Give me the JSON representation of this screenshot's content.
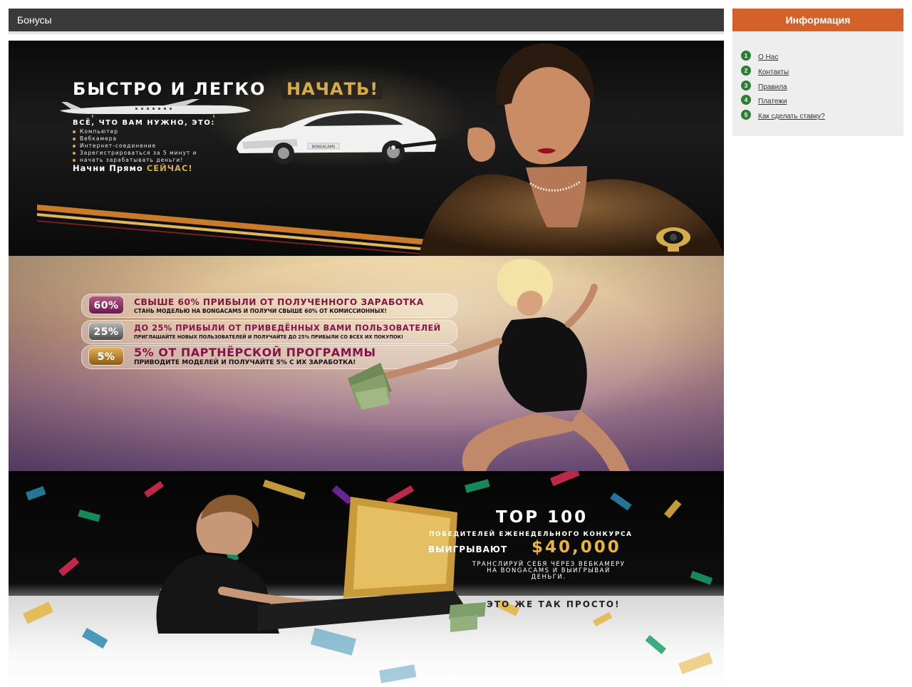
{
  "section": {
    "title": "Бонусы"
  },
  "banners": {
    "b1": {
      "title": "БЫСТРО И ЛЕГКО",
      "title_highlight": "НАЧАТЬ!",
      "needs_title": "ВСЁ, ЧТО ВАМ НУЖНО, ЭТО:",
      "needs": [
        "Компьютер",
        "Вебкамера",
        "Интернет-соединение",
        "Зарегистрироваться за 5 минут и",
        "начать зарабатывать деньги!"
      ],
      "cta": "Начни Прямо",
      "cta_highlight": "СЕЙЧАС!",
      "car_plate": "BONGACAMS"
    },
    "b2": {
      "rows": [
        {
          "badge": "60%",
          "headline": "СВЫШЕ 60% ПРИБЫЛИ ОТ ПОЛУЧЕННОГО ЗАРАБОТКА",
          "subline": "СТАНЬ МОДЕЛЬЮ НА BONGACAMS И ПОЛУЧИ СВЫШЕ 60% ОТ КОМИССИОННЫХ!"
        },
        {
          "badge": "25%",
          "headline": "ДО 25% ПРИБЫЛИ ОТ ПРИВЕДЁННЫХ ВАМИ ПОЛЬЗОВАТЕЛЕЙ",
          "subline": "ПРИГЛАШАЙТЕ НОВЫХ ПОЛЬЗОВАТЕЛЕЙ И ПОЛУЧАЙТЕ ДО 25% ПРИБЫЛИ СО ВСЕХ ИХ ПОКУПОК!"
        },
        {
          "badge": "5%",
          "headline": "5% ОТ ПАРТНЁРСКОЙ ПРОГРАММЫ",
          "subline": "ПРИВОДИТЕ МОДЕЛЕЙ И ПОЛУЧАЙТЕ 5% С ИХ ЗАРАБОТКА!"
        }
      ]
    },
    "b3": {
      "top": "TOP 100",
      "line1": "ПОБЕДИТЕЛЕЙ ЕЖЕНЕДЕЛЬНОГО КОНКУРСА",
      "win": "ВЫИГРЫВАЮТ",
      "amount": "$40,000",
      "desc": "ТРАНСЛИРУЙ СЕБЯ ЧЕРЕЗ ВЕБКАМЕРУ НА BONGACAMS И ВЫИГРЫВАЙ ДЕНЬГИ.",
      "easy": "ЭТО ЖЕ ТАК ПРОСТО!"
    }
  },
  "sidebar": {
    "title": "Информация",
    "items": [
      {
        "num": "1",
        "label": "О Нас"
      },
      {
        "num": "2",
        "label": "Контакты"
      },
      {
        "num": "3",
        "label": "Правила"
      },
      {
        "num": "4",
        "label": "Платежи"
      },
      {
        "num": "5",
        "label": "Как сделать ставку?"
      }
    ]
  },
  "colors": {
    "header_bg": "#3a3a3a",
    "sidebar_accent": "#d4612a",
    "list_number": "#2f7d32",
    "gold": "#d6ac4a",
    "magenta": "#86144a"
  }
}
